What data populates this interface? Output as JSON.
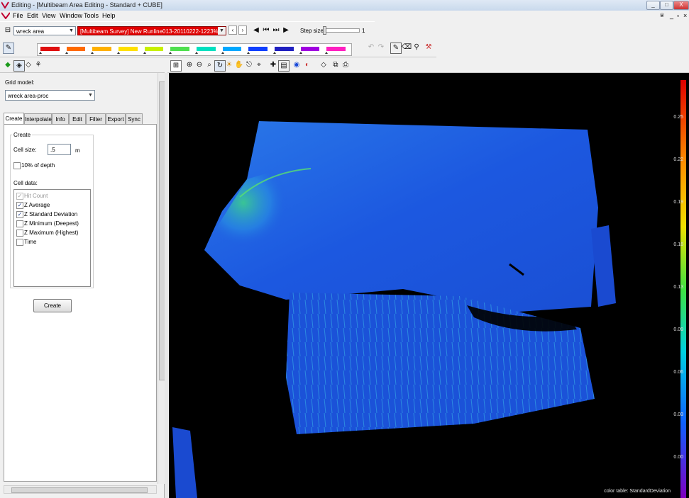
{
  "window": {
    "title": "Editing - [Multibeam Area Editing - Standard + CUBE]",
    "controls": [
      "_",
      "□",
      "X"
    ]
  },
  "menu": [
    "File",
    "Edit",
    "View",
    "Window",
    "Tools",
    "Help"
  ],
  "toolbar": {
    "area_combo": "wreck area",
    "line_combo": "[Multibeam Survey] New Runline013-20110222-1223%...",
    "step_label": "Step size",
    "step_value": "1"
  },
  "colors": {
    "accent_red": "#e00000",
    "viewport_bg": "#000000",
    "data_blue": "#1e5ae6",
    "data_green": "#2ddc8c"
  },
  "color_strip": [
    "#e01010",
    "#ff6a00",
    "#ffb000",
    "#ffe000",
    "#c8f000",
    "#50e050",
    "#00e0c0",
    "#00a8ff",
    "#1040ff",
    "#2020c0",
    "#a000e0",
    "#ff20c0"
  ],
  "left": {
    "grid_model_label": "Grid model:",
    "grid_model_value": "wreck area-proc",
    "tabs": [
      "Create",
      "Interpolate",
      "Info",
      "Edit",
      "Filter",
      "Export",
      "Sync"
    ],
    "active_tab": "Create",
    "group_label": "Create",
    "cell_size_label": "Cell size:",
    "cell_size_value": ".5",
    "cell_size_unit": "m",
    "depth_pct_label": "10% of depth",
    "cell_data_label": "Cell data:",
    "cell_data_items": [
      {
        "label": "Hit Count",
        "checked": true,
        "disabled": true
      },
      {
        "label": "Z Average",
        "checked": true,
        "disabled": false
      },
      {
        "label": "Z Standard Deviation",
        "checked": true,
        "disabled": false
      },
      {
        "label": "Z Minimum (Deepest)",
        "checked": false,
        "disabled": false
      },
      {
        "label": "Z Maximum (Highest)",
        "checked": false,
        "disabled": false
      },
      {
        "label": "Time",
        "checked": false,
        "disabled": false
      }
    ],
    "create_button": "Create"
  },
  "viewport": {
    "color_scale_ticks": [
      "0.25",
      "0.22",
      "0.19",
      "0.16",
      "0.13",
      "0.09",
      "0.06",
      "0.03",
      "0.00"
    ],
    "color_table_label": "color table: StandardDeviation"
  }
}
